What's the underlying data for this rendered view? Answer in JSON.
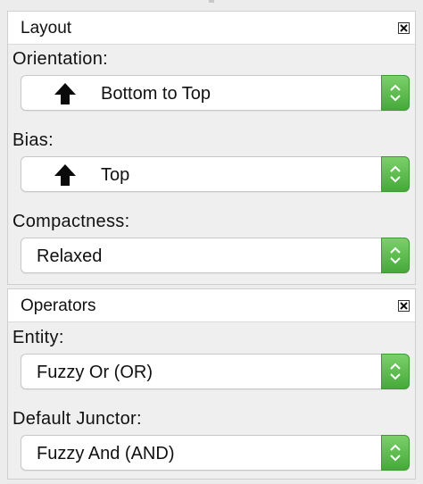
{
  "layout_panel": {
    "title": "Layout",
    "orientation": {
      "label": "Orientation:",
      "value": "Bottom to Top",
      "icon": "arrow-up-icon"
    },
    "bias": {
      "label": "Bias:",
      "value": "Top",
      "icon": "arrow-up-icon"
    },
    "compactness": {
      "label": "Compactness:",
      "value": "Relaxed"
    }
  },
  "operators_panel": {
    "title": "Operators",
    "entity": {
      "label": "Entity:",
      "value": "Fuzzy Or (OR)"
    },
    "default_junctor": {
      "label": "Default Junctor:",
      "value": "Fuzzy And (AND)"
    }
  },
  "colors": {
    "stepper_green": "#46a93a",
    "panel_background": "#efefef",
    "header_background": "#ffffff"
  }
}
